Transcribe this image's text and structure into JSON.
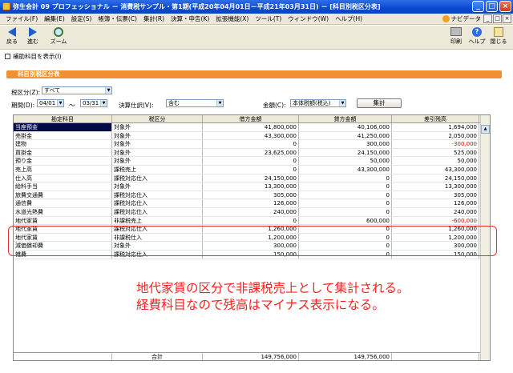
{
  "window": {
    "title": "弥生会計 09 プロフェッショナル － 消費税サンプル・第1期(平成20年04月01日－平成21年03月31日) － [科目別税区分表]",
    "min_label": "_",
    "max_label": "□",
    "close_label": "×"
  },
  "menu": {
    "items": [
      "ファイル(F)",
      "編集(E)",
      "設定(S)",
      "帳簿・伝票(C)",
      "集計(R)",
      "決算・申告(K)",
      "拡張機能(X)",
      "ツール(T)",
      "ウィンドウ(W)",
      "ヘルプ(H)"
    ],
    "navi_label": "ナビデータ"
  },
  "toolbar": {
    "back_label": "戻る",
    "forward_label": "進む",
    "zoom_label": "ズーム",
    "print_label": "印刷",
    "help_label": "ヘルプ",
    "close_label": "閉じる"
  },
  "subbar": {
    "show_aux_label": "補助科目を表示(I)"
  },
  "panel": {
    "title": "科目別税区分表"
  },
  "filters": {
    "tax_class_label": "税区分(Z):",
    "tax_class_value": "すべて",
    "period_label": "期間(D):",
    "period_from": "04/01",
    "period_sep": "〜",
    "period_to": "03/31",
    "closing_label": "決算仕訳(V):",
    "closing_value": "含む",
    "amount_label": "金額(C):",
    "amount_value": "本体税額(税込)",
    "aggregate_button": "集計"
  },
  "table": {
    "headers": [
      "勘定科目",
      "税区分",
      "借方金額",
      "貸方金額",
      "差引残高"
    ],
    "rows": [
      [
        "当座預金",
        "対象外",
        "41,800,000",
        "40,106,000",
        "1,694,000"
      ],
      [
        "売掛金",
        "対象外",
        "43,300,000",
        "41,250,000",
        "2,050,000"
      ],
      [
        "建物",
        "対象外",
        "0",
        "300,000",
        "-300,000"
      ],
      [
        "買掛金",
        "対象外",
        "23,625,000",
        "24,150,000",
        "525,000"
      ],
      [
        "預り金",
        "対象外",
        "0",
        "50,000",
        "50,000"
      ],
      [
        "売上高",
        "課税売上",
        "0",
        "43,300,000",
        "43,300,000"
      ],
      [
        "仕入高",
        "課税対応仕入",
        "24,150,000",
        "0",
        "24,150,000"
      ],
      [
        "給料手当",
        "対象外",
        "13,300,000",
        "0",
        "13,300,000"
      ],
      [
        "旅費交通費",
        "課税対応仕入",
        "305,000",
        "0",
        "305,000"
      ],
      [
        "通信費",
        "課税対応仕入",
        "126,000",
        "0",
        "126,000"
      ],
      [
        "水道光熱費",
        "課税対応仕入",
        "240,000",
        "0",
        "240,000"
      ],
      [
        "地代家賃",
        "非課税売上",
        "0",
        "600,000",
        "-600,000"
      ],
      [
        "地代家賃",
        "課税対応仕入",
        "1,260,000",
        "0",
        "1,260,000"
      ],
      [
        "地代家賃",
        "非課税仕入",
        "1,200,000",
        "0",
        "1,200,000"
      ],
      [
        "減価償却費",
        "対象外",
        "300,000",
        "0",
        "300,000"
      ],
      [
        "雑費",
        "課税対応仕入",
        "150,000",
        "0",
        "150,000"
      ]
    ],
    "total_label": "合計",
    "total_debit": "149,756,000",
    "total_credit": "149,756,000"
  },
  "annotation": {
    "line1": "地代家賃の区分で非課税売上として集計される。",
    "line2": "経費科目なので残高はマイナス表示になる。"
  },
  "colors": {
    "title_bar": "#0a4ad0",
    "panel_header": "#f09030",
    "negative": "#e00000",
    "annotation": "#ff2020"
  }
}
